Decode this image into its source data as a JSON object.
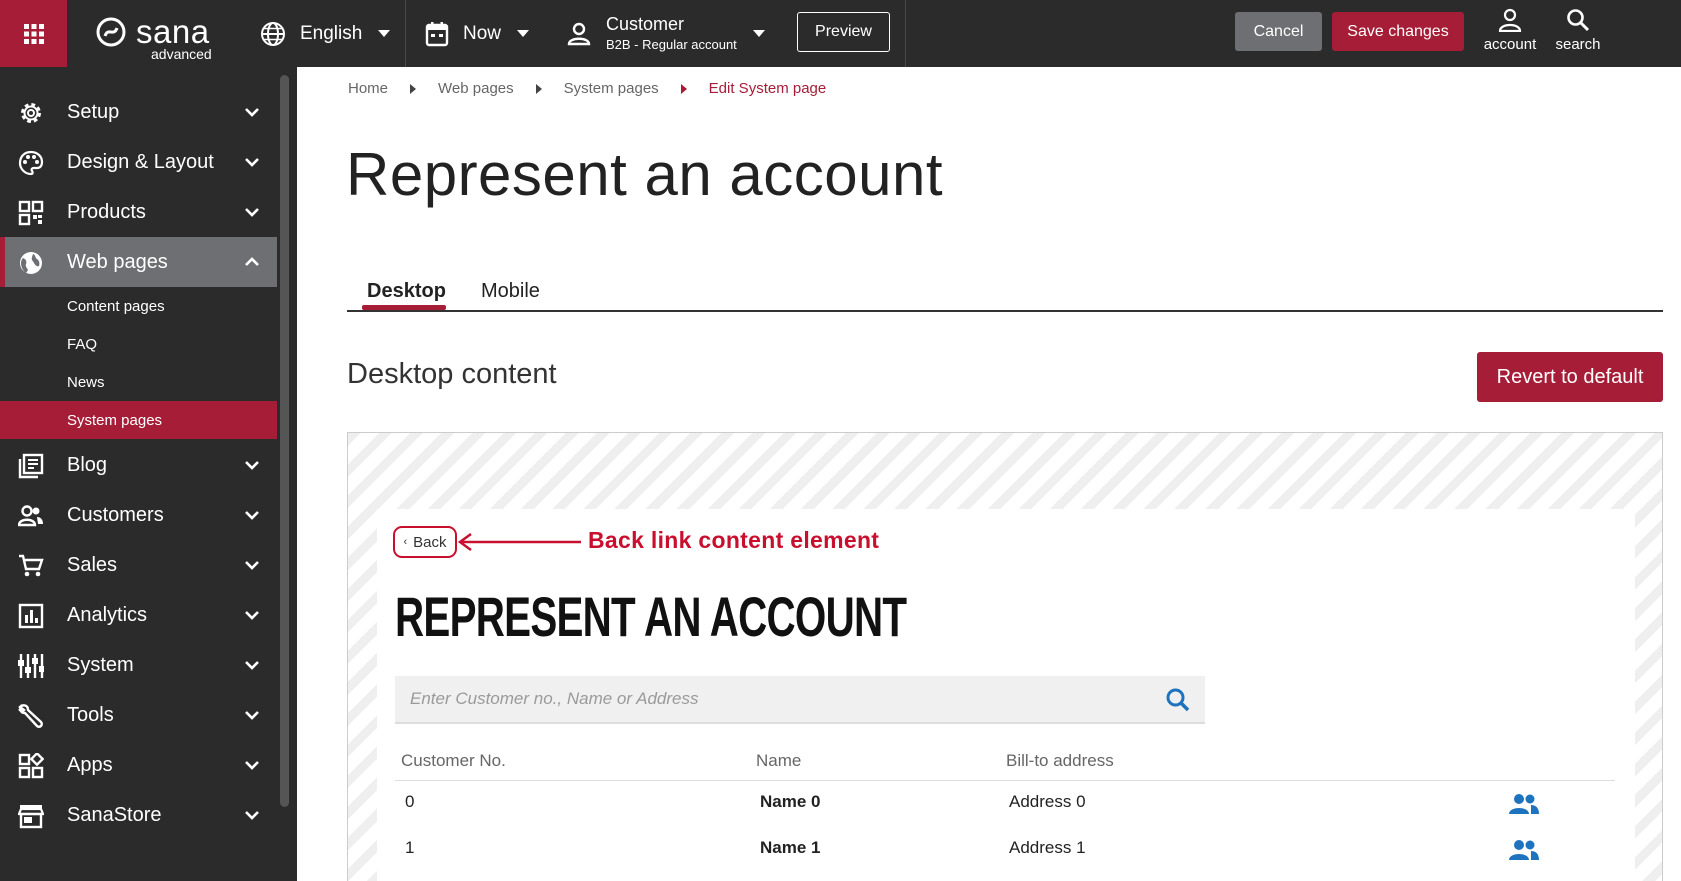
{
  "topbar": {
    "logo_word": "sana",
    "logo_sub": "advanced",
    "language": "English",
    "time": "Now",
    "customer_title": "Customer",
    "customer_sub": "B2B - Regular account",
    "preview_label": "Preview",
    "cancel_label": "Cancel",
    "save_label": "Save changes",
    "account_label": "account",
    "search_label": "search"
  },
  "sidebar": {
    "items": [
      {
        "label": "Setup",
        "icon": "gear-icon"
      },
      {
        "label": "Design & Layout",
        "icon": "palette-icon"
      },
      {
        "label": "Products",
        "icon": "qr-grid-icon"
      },
      {
        "label": "Web pages",
        "icon": "globe-icon"
      },
      {
        "label": "Blog",
        "icon": "blog-icon"
      },
      {
        "label": "Customers",
        "icon": "people-icon"
      },
      {
        "label": "Sales",
        "icon": "cart-icon"
      },
      {
        "label": "Analytics",
        "icon": "analytics-icon"
      },
      {
        "label": "System",
        "icon": "sliders-icon"
      },
      {
        "label": "Tools",
        "icon": "wrench-icon"
      },
      {
        "label": "Apps",
        "icon": "apps-icon"
      },
      {
        "label": "SanaStore",
        "icon": "store-icon"
      }
    ],
    "sub_items": [
      "Content pages",
      "FAQ",
      "News",
      "System pages"
    ]
  },
  "breadcrumb": [
    "Home",
    "Web pages",
    "System pages",
    "Edit System page"
  ],
  "page_title": "Represent an account",
  "tabs": [
    "Desktop",
    "Mobile"
  ],
  "section_title": "Desktop content",
  "revert_label": "Revert to default",
  "preview": {
    "back_label": "Back",
    "annotation": "Back link content element",
    "heading": "REPRESENT AN ACCOUNT",
    "search_placeholder": "Enter Customer no., Name or Address",
    "columns": [
      "Customer No.",
      "Name",
      "Bill-to address"
    ],
    "rows": [
      {
        "no": "0",
        "name": "Name 0",
        "address": "Address 0"
      },
      {
        "no": "1",
        "name": "Name 1",
        "address": "Address 1"
      }
    ]
  },
  "colors": {
    "brand": "#a51d36",
    "topbar": "#2b2b2b",
    "annotation": "#c8102e",
    "icon_blue": "#1e73be"
  }
}
